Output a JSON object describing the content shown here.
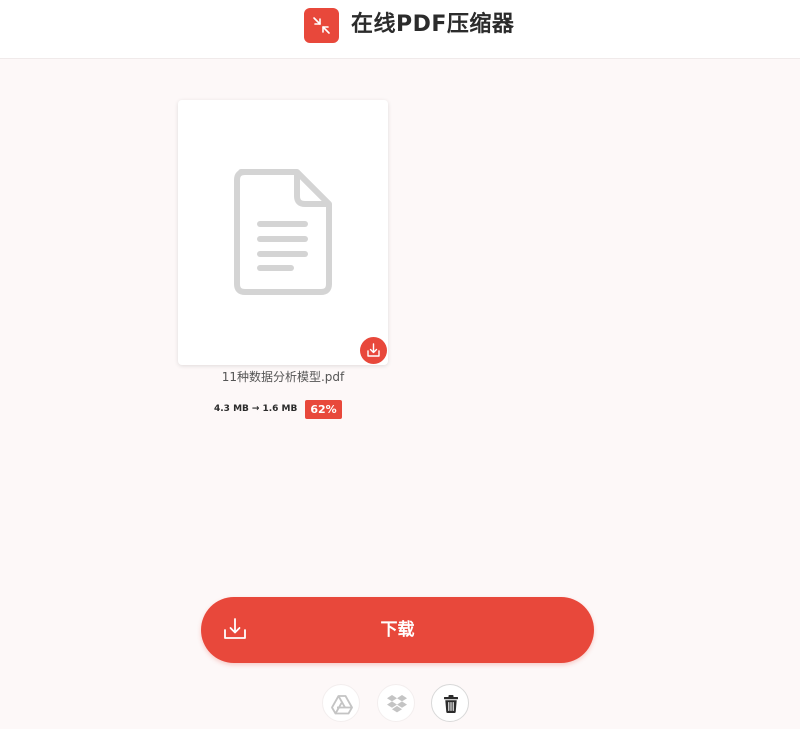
{
  "header": {
    "title": "在线PDF压缩器",
    "logo_icon": "compress-arrows-icon",
    "accent": "#e8483b"
  },
  "file": {
    "name": "11种数据分析模型.pdf",
    "original_size": "4.3 MB",
    "arrow": "→",
    "compressed_size": "1.6 MB",
    "reduction": "62%"
  },
  "actions": {
    "download_label": "下载",
    "icons": [
      "google-drive-icon",
      "dropbox-icon",
      "trash-icon"
    ]
  }
}
